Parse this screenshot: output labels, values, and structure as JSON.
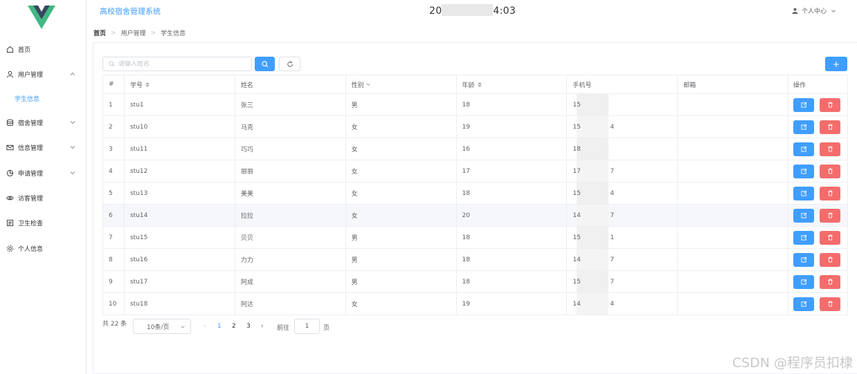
{
  "sidebar": {
    "logo": "vue-logo",
    "items": [
      {
        "label": "首页",
        "icon": "home-icon"
      },
      {
        "label": "用户管理",
        "icon": "user-icon",
        "expanded": true
      },
      {
        "label": "学生信息",
        "sub": true,
        "active": true
      },
      {
        "label": "宿舍管理",
        "icon": "database-icon"
      },
      {
        "label": "信息管理",
        "icon": "mail-icon"
      },
      {
        "label": "申请管理",
        "icon": "pie-chart-icon"
      },
      {
        "label": "访客管理",
        "icon": "eye-icon"
      },
      {
        "label": "卫生检查",
        "icon": "document-icon"
      },
      {
        "label": "个人信息",
        "icon": "gear-icon"
      }
    ]
  },
  "header": {
    "title": "高校宿舍管理系统",
    "clock_prefix": "20",
    "clock_suffix": "4:03",
    "user_menu": "个人中心"
  },
  "breadcrumb": [
    "首页",
    "用户管理",
    "学生信息"
  ],
  "toolbar": {
    "search_placeholder": "请输入姓名",
    "search_value": ""
  },
  "table": {
    "columns": [
      "#",
      "学号",
      "姓名",
      "性别",
      "年龄",
      "手机号",
      "邮箱",
      "操作"
    ],
    "rows": [
      {
        "idx": "1",
        "id": "stu1",
        "name": "张三",
        "gender": "男",
        "age": "18",
        "phone_head": "15",
        "phone_tail": "",
        "email": ""
      },
      {
        "idx": "2",
        "id": "stu10",
        "name": "马克",
        "gender": "女",
        "age": "19",
        "phone_head": "15",
        "phone_tail": "4",
        "email": ""
      },
      {
        "idx": "3",
        "id": "stu11",
        "name": "巧巧",
        "gender": "女",
        "age": "16",
        "phone_head": "18",
        "phone_tail": "",
        "email": ""
      },
      {
        "idx": "4",
        "id": "stu12",
        "name": "丽丽",
        "gender": "女",
        "age": "17",
        "phone_head": "17",
        "phone_tail": "7",
        "email": ""
      },
      {
        "idx": "5",
        "id": "stu13",
        "name": "美美",
        "gender": "女",
        "age": "18",
        "phone_head": "15",
        "phone_tail": "4",
        "email": ""
      },
      {
        "idx": "6",
        "id": "stu14",
        "name": "拉拉",
        "gender": "女",
        "age": "20",
        "phone_head": "14",
        "phone_tail": "7",
        "email": ""
      },
      {
        "idx": "7",
        "id": "stu15",
        "name": "贝贝",
        "gender": "男",
        "age": "18",
        "phone_head": "15",
        "phone_tail": "1",
        "email": ""
      },
      {
        "idx": "8",
        "id": "stu16",
        "name": "力力",
        "gender": "男",
        "age": "18",
        "phone_head": "14",
        "phone_tail": "7",
        "email": ""
      },
      {
        "idx": "9",
        "id": "stu17",
        "name": "阿成",
        "gender": "男",
        "age": "18",
        "phone_head": "15",
        "phone_tail": "7",
        "email": ""
      },
      {
        "idx": "10",
        "id": "stu18",
        "name": "阿达",
        "gender": "女",
        "age": "19",
        "phone_head": "14",
        "phone_tail": "4",
        "email": ""
      }
    ],
    "highlight_row": 6
  },
  "pagination": {
    "total_text": "共 22 条",
    "page_size": "10条/页",
    "pages": [
      "1",
      "2",
      "3"
    ],
    "current_page": "1",
    "goto_label": "前往",
    "goto_value": "1",
    "page_unit": "页"
  },
  "watermark": "CSDN @程序员扣棣",
  "colors": {
    "primary": "#409eff",
    "danger": "#f56c6c",
    "logo_green": "#41b883",
    "logo_dark": "#35495e"
  }
}
